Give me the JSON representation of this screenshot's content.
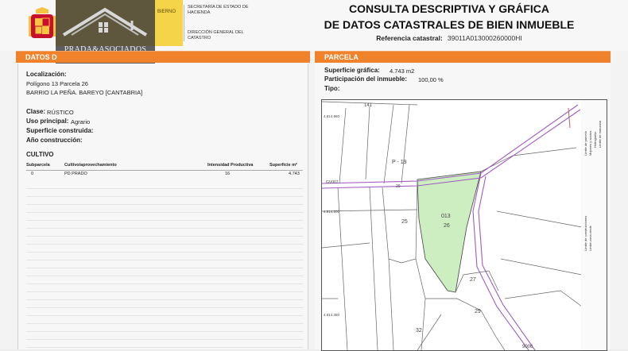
{
  "header": {
    "gob_text": "BIERNO",
    "org_line1": "SECRETARÍA DE ESTADO DE HACIENDA",
    "org_line2": "DIRECCIÓN GENERAL DEL CATASTRO",
    "watermark_brand": "PRADA&ASOCIADOS"
  },
  "document": {
    "title_line1": "CONSULTA DESCRIPTIVA Y GRÁFICA",
    "title_line2": "DE DATOS CATASTRALES DE BIEN INMUEBLE",
    "ref_label": "Referencia catastral:",
    "ref_value": "39011A013000260000HI"
  },
  "left": {
    "section_title": "DATOS D",
    "localizacion_label": "Localización:",
    "address_line1": "Polígono 13 Parcela 26",
    "address_line2": "BARRIO LA PEÑA. BAREYO [CANTABRIA]",
    "clase_label": "Clase:",
    "clase_value": "RÚSTICO",
    "uso_label": "Uso principal:",
    "uso_value": "Agrario",
    "superficie_label": "Superficie construida:",
    "anio_label": "Año construcción:",
    "cultivo_title": "CULTIVO",
    "table": {
      "headers": [
        "Subparcela",
        "Cultivo/aprovechamiento",
        "Intensidad Productiva",
        "Superficie m²"
      ],
      "rows": [
        [
          "0",
          "PD PRADO",
          "16",
          "4.743"
        ]
      ]
    }
  },
  "right": {
    "section_title": "PARCELA",
    "superficie_label": "Superficie gráfica:",
    "superficie_value": "4.743 m2",
    "participacion_label": "Participación del inmueble:",
    "participacion_value": "100,00 %",
    "tipo_label": "Tipo:"
  },
  "map": {
    "parcel_labels": [
      "141",
      "P - 19",
      "GV007",
      "29",
      "013",
      "26",
      "25",
      "27",
      "29",
      "32",
      "9006"
    ],
    "coord_labels": [
      "4.814.960",
      "4.814.600",
      "4.814.360"
    ],
    "highlight_color": "#cdeec0",
    "road_color": "#a05cc0"
  },
  "legend": {
    "items": [
      "Límite de parcela",
      "Mojones y aceras",
      "Hidrografía",
      "Límite de manzana",
      "Límite de construcciones",
      "Límite zona verde"
    ]
  }
}
